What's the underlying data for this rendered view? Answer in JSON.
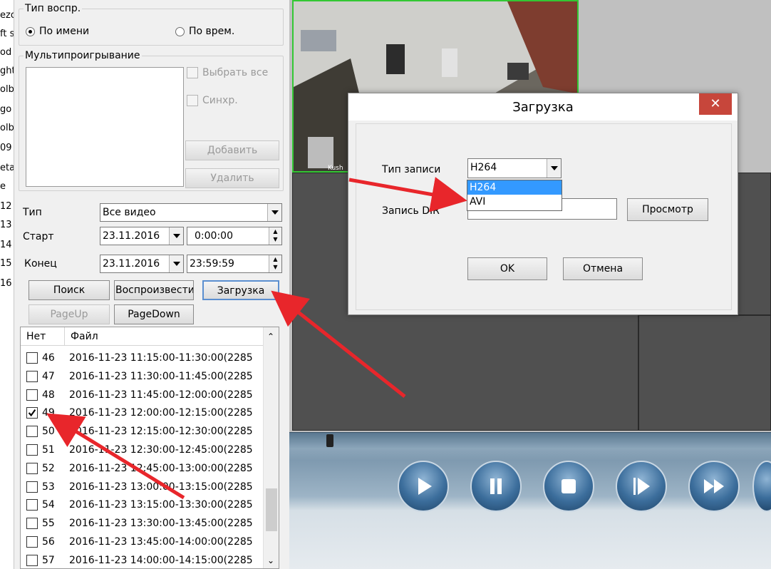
{
  "left_strip": [
    "ezo",
    "ft s",
    "od",
    "ght",
    "olb",
    "go",
    "olb",
    "09",
    "eta",
    "e",
    "12",
    "13",
    "14",
    "15",
    "16"
  ],
  "playback_type": {
    "legend": "Тип воспр.",
    "by_name": "По имени",
    "by_time": "По врем.",
    "selected": "by_name"
  },
  "multiplay": {
    "legend": "Мультипроигрывание",
    "select_all": "Выбрать все",
    "sync": "Синхр.",
    "add": "Добавить",
    "remove": "Удалить"
  },
  "filters": {
    "type_label": "Тип",
    "type_value": "Все видео",
    "start_label": "Старт",
    "start_date": "23.11.2016",
    "start_time": "0:00:00",
    "end_label": "Конец",
    "end_date": "23.11.2016",
    "end_time": "23:59:59"
  },
  "actions": {
    "search": "Поиск",
    "play": "Воспроизвести",
    "download": "Загрузка",
    "page_up": "PageUp",
    "page_down": "PageDown"
  },
  "file_list": {
    "headers": [
      "Нет",
      "Файл"
    ],
    "rows": [
      {
        "no": "46",
        "file": "2016-11-23 11:15:00-11:30:00(2285",
        "checked": false
      },
      {
        "no": "47",
        "file": "2016-11-23 11:30:00-11:45:00(2285",
        "checked": false
      },
      {
        "no": "48",
        "file": "2016-11-23 11:45:00-12:00:00(2285",
        "checked": false
      },
      {
        "no": "49",
        "file": "2016-11-23 12:00:00-12:15:00(2285",
        "checked": true
      },
      {
        "no": "50",
        "file": "2016-11-23 12:15:00-12:30:00(2285",
        "checked": false
      },
      {
        "no": "51",
        "file": "2016-11-23 12:30:00-12:45:00(2285",
        "checked": false
      },
      {
        "no": "52",
        "file": "2016-11-23 12:45:00-13:00:00(2285",
        "checked": false
      },
      {
        "no": "53",
        "file": "2016-11-23 13:00:00-13:15:00(2285",
        "checked": false
      },
      {
        "no": "54",
        "file": "2016-11-23 13:15:00-13:30:00(2285",
        "checked": false
      },
      {
        "no": "55",
        "file": "2016-11-23 13:30:00-13:45:00(2285",
        "checked": false
      },
      {
        "no": "56",
        "file": "2016-11-23 13:45:00-14:00:00(2285",
        "checked": false
      },
      {
        "no": "57",
        "file": "2016-11-23 14:00:00-14:15:00(2285",
        "checked": false
      }
    ]
  },
  "camera_overlay": "Kush",
  "player_buttons": [
    "play-icon",
    "pause-icon",
    "stop-icon",
    "step-forward-icon",
    "fast-forward-icon"
  ],
  "dialog": {
    "title": "Загрузка",
    "close": "✕",
    "record_type_label": "Тип записи",
    "record_type_value": "H264",
    "record_type_options": [
      "H264",
      "AVI"
    ],
    "record_dir_label": "Запись DIR",
    "browse": "Просмотр",
    "ok": "OK",
    "cancel": "Отмена"
  },
  "colors": {
    "arrow": "#e8262b",
    "selection": "#3399ff",
    "close_button": "#c7463b",
    "camera_border": "#33c733"
  }
}
